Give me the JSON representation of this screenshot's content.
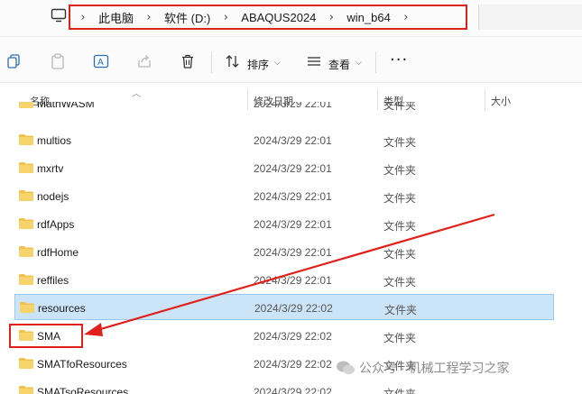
{
  "breadcrumb": [
    "此电脑",
    "软件 (D:)",
    "ABAQUS2024",
    "win_b64"
  ],
  "toolbar": {
    "sort_label": "排序",
    "view_label": "查看"
  },
  "columns": {
    "name": "名称",
    "date": "修改日期",
    "type": "类型",
    "size": "大小"
  },
  "files": [
    {
      "name": "MathWASM",
      "date": "2024/3/29 22:01",
      "type": "文件夹"
    },
    {
      "name": "multios",
      "date": "2024/3/29 22:01",
      "type": "文件夹"
    },
    {
      "name": "mxrtv",
      "date": "2024/3/29 22:01",
      "type": "文件夹"
    },
    {
      "name": "nodejs",
      "date": "2024/3/29 22:01",
      "type": "文件夹"
    },
    {
      "name": "rdfApps",
      "date": "2024/3/29 22:01",
      "type": "文件夹"
    },
    {
      "name": "rdfHome",
      "date": "2024/3/29 22:01",
      "type": "文件夹"
    },
    {
      "name": "reffiles",
      "date": "2024/3/29 22:01",
      "type": "文件夹"
    },
    {
      "name": "resources",
      "date": "2024/3/29 22:02",
      "type": "文件夹"
    },
    {
      "name": "SMA",
      "date": "2024/3/29 22:02",
      "type": "文件夹"
    },
    {
      "name": "SMATfoResources",
      "date": "2024/3/29 22:02",
      "type": "文件夹"
    },
    {
      "name": "SMATsoResources",
      "date": "2024/3/29 22:02",
      "type": "文件夹"
    }
  ],
  "watermark": "公众号 · 机械工程学习之家",
  "colors": {
    "annotation": "#e0201a",
    "selection": "#cce4f7",
    "folder": "#f2c14e"
  }
}
